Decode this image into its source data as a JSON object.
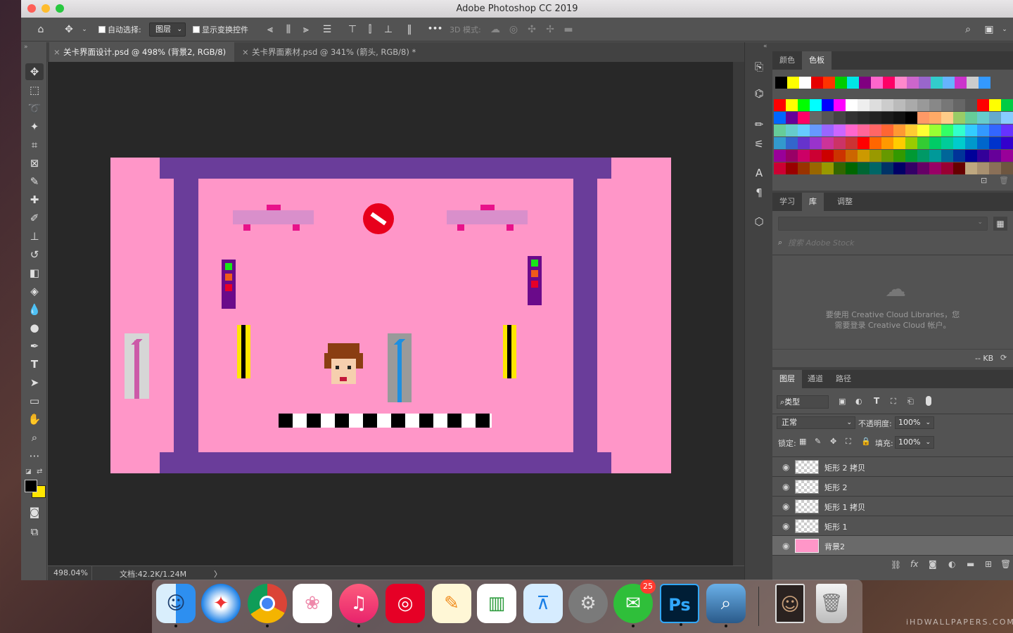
{
  "window": {
    "title": "Adobe Photoshop CC 2019"
  },
  "options_bar": {
    "auto_select_label": "自动选择:",
    "auto_select_value": "图层",
    "show_transform_label": "显示变换控件",
    "more": "•••",
    "mode_3d_label": "3D 模式:"
  },
  "tabs": [
    {
      "label": "关卡界面设计.psd @ 498% (背景2, RGB/8)",
      "active": true
    },
    {
      "label": "关卡界面素材.psd @ 341% (箭头, RGB/8) *",
      "active": false
    }
  ],
  "status": {
    "zoom": "498.04%",
    "doc": "文档:42.2K/1.24M",
    "arrow": "〉"
  },
  "swatches_panel": {
    "tabs": [
      "颜色",
      "色板"
    ]
  },
  "library_panel": {
    "tabs": [
      "学习",
      "库",
      "调整"
    ],
    "search_placeholder": "搜索 Adobe Stock",
    "message_line1": "要使用 Creative Cloud Libraries，您",
    "message_line2": "需要登录 Creative Cloud 帐户。",
    "kb": "-- KB"
  },
  "layers_panel": {
    "tabs": [
      "图层",
      "通道",
      "路径"
    ],
    "filter": "类型",
    "blend_mode": "正常",
    "opacity_label": "不透明度:",
    "opacity_value": "100%",
    "lock_label": "锁定:",
    "fill_label": "填充:",
    "fill_value": "100%",
    "layers": [
      "矩形 2 拷贝",
      "矩形 2",
      "矩形 1 拷贝",
      "矩形 1",
      "背景2"
    ]
  },
  "dock": {
    "wechat_badge": "25"
  },
  "watermark": "iHDWALLPAPERS.COM",
  "colors": {
    "canvas_pink": "#ff96c8",
    "frame_purple": "#6a3d9a",
    "photoshop_blue": "#31a8ff"
  }
}
